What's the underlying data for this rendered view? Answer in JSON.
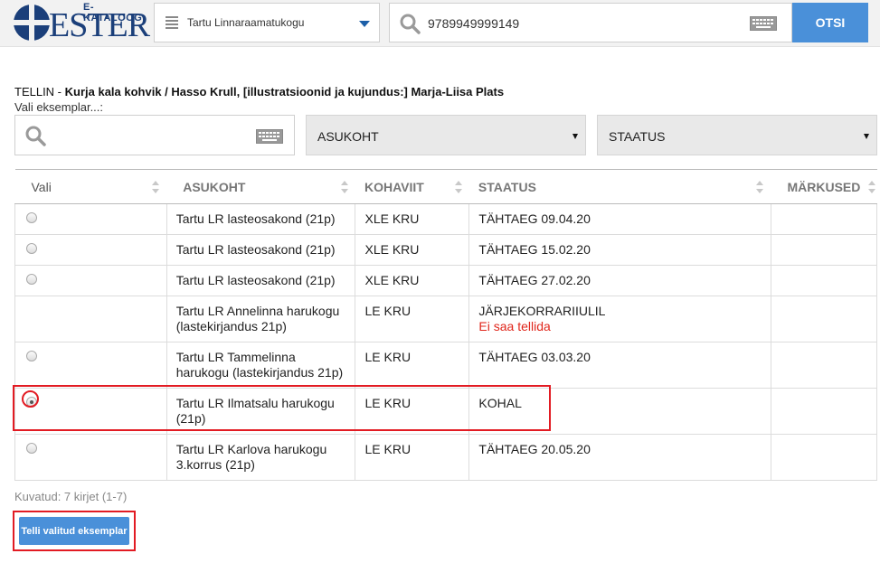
{
  "header": {
    "logo_top": "E-KATALOOG",
    "logo_main": "ESTER",
    "library_select": "Tartu Linnaraamatukogu",
    "search_value": "9789949999149",
    "search_button": "OTSI"
  },
  "order": {
    "prefix": "TELLIN - ",
    "title": "Kurja kala kohvik / Hasso Krull, [illustratsioonid ja kujundus:] Marja-Liisa Plats",
    "choose_label": "Vali eksemplar...:",
    "filter_location": "ASUKOHT",
    "filter_status": "STAATUS"
  },
  "table": {
    "headers": {
      "vali": "Vali",
      "asukoht": "ASUKOHT",
      "kohaviit": "KOHAVIIT",
      "staatus": "STAATUS",
      "markused": "MÄRKUSED"
    },
    "rows": [
      {
        "location": "Tartu LR lasteosakond (21p)",
        "callno": "XLE KRU",
        "status": "TÄHTAEG 09.04.20",
        "note": "",
        "selected": false
      },
      {
        "location": "Tartu LR lasteosakond (21p)",
        "callno": "XLE KRU",
        "status": "TÄHTAEG 15.02.20",
        "note": "",
        "selected": false
      },
      {
        "location": "Tartu LR lasteosakond (21p)",
        "callno": "XLE KRU",
        "status": "TÄHTAEG 27.02.20",
        "note": "",
        "selected": false
      },
      {
        "location": "Tartu LR Annelinna harukogu (lastekirjandus 21p)",
        "callno": "LE KRU",
        "status": "JÄRJEKORRARIIULIL",
        "note": "Ei saa tellida",
        "selected": false
      },
      {
        "location": "Tartu LR Tammelinna harukogu (lastekirjandus 21p)",
        "callno": "LE KRU",
        "status": "TÄHTAEG 03.03.20",
        "note": "",
        "selected": false
      },
      {
        "location": "Tartu LR Ilmatsalu harukogu (21p)",
        "callno": "LE KRU",
        "status": "KOHAL",
        "note": "",
        "selected": true
      },
      {
        "location": "Tartu LR Karlova harukogu 3.korrus (21p)",
        "callno": "LE KRU",
        "status": "TÄHTAEG 20.05.20",
        "note": "",
        "selected": false
      }
    ]
  },
  "footer": {
    "count": "Kuvatud: 7 kirjet (1-7)",
    "order_button": "Telli valitud eksemplar"
  },
  "colors": {
    "accent": "#4a90d9",
    "logo": "#1b3f7a",
    "highlight": "#e21b23",
    "error": "#e0261b"
  }
}
